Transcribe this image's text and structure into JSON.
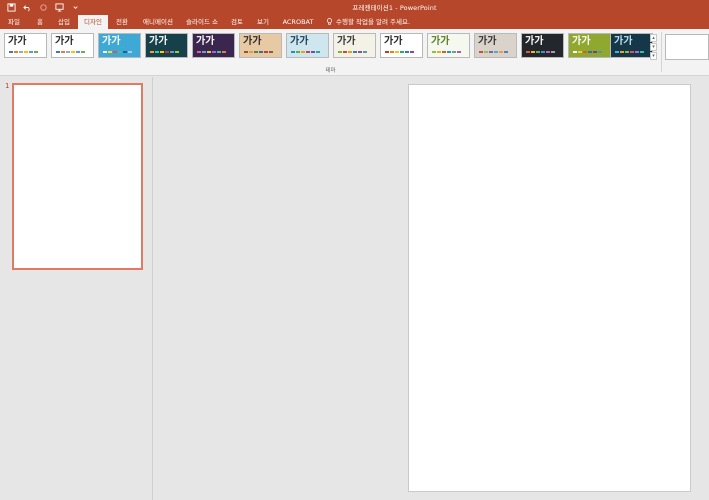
{
  "window": {
    "title": "프레젠테이션1 - PowerPoint",
    "accent_color": "#b7472a"
  },
  "quick_access": [
    {
      "name": "save-icon"
    },
    {
      "name": "undo-icon"
    },
    {
      "name": "redo-icon"
    },
    {
      "name": "present-icon"
    },
    {
      "name": "customize-icon"
    }
  ],
  "tabs": [
    {
      "label": "파일",
      "active": false
    },
    {
      "label": "홈",
      "active": false
    },
    {
      "label": "삽입",
      "active": false
    },
    {
      "label": "디자인",
      "active": true
    },
    {
      "label": "전환",
      "active": false
    },
    {
      "label": "애니메이션",
      "active": false
    },
    {
      "label": "슬라이드 쇼",
      "active": false
    },
    {
      "label": "검토",
      "active": false
    },
    {
      "label": "보기",
      "active": false
    },
    {
      "label": "ACROBAT",
      "active": false
    }
  ],
  "tell_me": {
    "text": "수행할 작업을 알려 주세요.",
    "icon": "lightbulb-icon"
  },
  "ribbon": {
    "group_label": "테마",
    "themes": [
      {
        "label": "가가",
        "bg": "#ffffff",
        "fg": "#222222",
        "swatches": [
          "#4472c4",
          "#ed7d31",
          "#a5a5a5",
          "#ffc000",
          "#5b9bd5",
          "#70ad47"
        ]
      },
      {
        "label": "가가",
        "bg": "#ffffff",
        "fg": "#222222",
        "swatches": [
          "#4472c4",
          "#ed7d31",
          "#a5a5a5",
          "#ffc000",
          "#5b9bd5",
          "#70ad47"
        ]
      },
      {
        "label": "가가",
        "bg": "#3fa9d6",
        "fg": "#ffffff",
        "swatches": [
          "#ffffff",
          "#f0e040",
          "#e05050",
          "#40c0a0",
          "#2060a0",
          "#a0d0f0"
        ]
      },
      {
        "label": "가가",
        "bg": "#16404a",
        "fg": "#ffffff",
        "swatches": [
          "#ff9933",
          "#33cc99",
          "#ffcc00",
          "#cc3333",
          "#6699cc",
          "#99cc33"
        ]
      },
      {
        "label": "가가",
        "bg": "#3b2650",
        "fg": "#ffffff",
        "swatches": [
          "#e06090",
          "#60a0e0",
          "#f0c040",
          "#a060e0",
          "#40c0a0",
          "#e08040"
        ]
      },
      {
        "label": "가가",
        "bg": "#e7c9a4",
        "fg": "#2a2a2a",
        "swatches": [
          "#a05030",
          "#d0a060",
          "#608040",
          "#3070a0",
          "#c04040",
          "#806040"
        ]
      },
      {
        "label": "가가",
        "bg": "#cfe6ee",
        "fg": "#1a4050",
        "swatches": [
          "#2090c0",
          "#60b040",
          "#f0a020",
          "#c04060",
          "#7050a0",
          "#30a0a0"
        ]
      },
      {
        "label": "가가",
        "bg": "#f4f1e7",
        "fg": "#333333",
        "swatches": [
          "#7fae3c",
          "#c05030",
          "#e0a020",
          "#3080b0",
          "#905090",
          "#50a0a0"
        ]
      },
      {
        "label": "가가",
        "bg": "#ffffff",
        "fg": "#222222",
        "swatches": [
          "#c0392b",
          "#e67e22",
          "#f1c40f",
          "#27ae60",
          "#2980b9",
          "#8e44ad"
        ]
      },
      {
        "label": "가가",
        "bg": "#f5f8ef",
        "fg": "#557a1e",
        "swatches": [
          "#90c040",
          "#e0b020",
          "#d06030",
          "#3090c0",
          "#70a090",
          "#a060a0"
        ]
      },
      {
        "label": "가가",
        "bg": "#d9d3cc",
        "fg": "#333333",
        "swatches": [
          "#c0504d",
          "#9bbb59",
          "#8064a2",
          "#4bacc6",
          "#f79646",
          "#4f81bd"
        ]
      },
      {
        "label": "가가",
        "bg": "#23272c",
        "fg": "#ffffff",
        "swatches": [
          "#e05a40",
          "#f0b030",
          "#60b060",
          "#4090d0",
          "#c060b0",
          "#a0a0a0"
        ]
      },
      {
        "label": "가가",
        "bg": "#90a830",
        "fg": "#ffffff",
        "swatches": [
          "#ffffff",
          "#f0d040",
          "#d06030",
          "#3070a0",
          "#704090",
          "#40a0a0"
        ]
      },
      {
        "label": "가가",
        "bg": "#163748",
        "fg": "#bfe4f0",
        "swatches": [
          "#40b0e0",
          "#f0a030",
          "#80c040",
          "#e05060",
          "#a070d0",
          "#30c0a0"
        ]
      }
    ]
  },
  "slides": [
    {
      "number": "1"
    }
  ]
}
